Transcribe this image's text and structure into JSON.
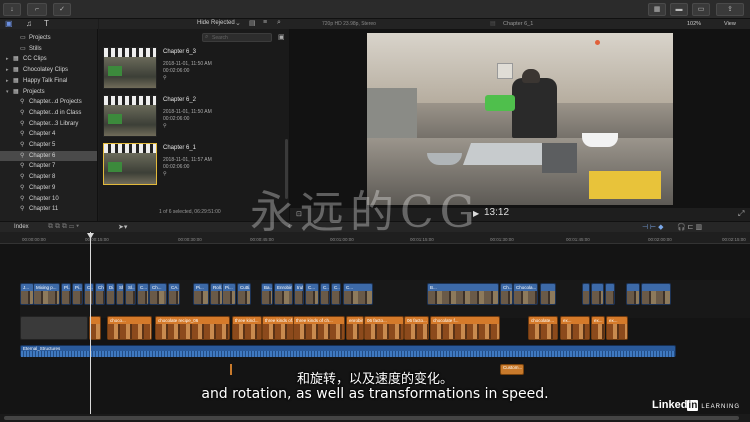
{
  "toolbar": {
    "filter_label": "Hide Rejected",
    "format": "720p HD 23.98p, Stereo",
    "viewer_title": "Chapter 6_1",
    "zoom": "102%",
    "view": "View"
  },
  "sidebar": {
    "items": [
      {
        "label": "Projects",
        "kind": "folder",
        "indent": 1
      },
      {
        "label": "Stills",
        "kind": "folder",
        "indent": 1
      },
      {
        "label": "CC Clips",
        "kind": "event",
        "indent": 0
      },
      {
        "label": "Chocolatey Clips",
        "kind": "event",
        "indent": 0
      },
      {
        "label": "Happy Talk Final",
        "kind": "event",
        "indent": 0
      },
      {
        "label": "Projects",
        "kind": "event",
        "indent": 0
      },
      {
        "label": "Chapter...d Projects",
        "kind": "keyword",
        "indent": 1
      },
      {
        "label": "Chapter...d in Class",
        "kind": "keyword",
        "indent": 1
      },
      {
        "label": "Chapter...3 Library",
        "kind": "keyword",
        "indent": 1
      },
      {
        "label": "Chapter 4",
        "kind": "keyword",
        "indent": 1
      },
      {
        "label": "Chapter 5",
        "kind": "keyword",
        "indent": 1
      },
      {
        "label": "Chapter 6",
        "kind": "keyword",
        "indent": 1,
        "selected": true
      },
      {
        "label": "Chapter 7",
        "kind": "keyword",
        "indent": 1
      },
      {
        "label": "Chapter 8",
        "kind": "keyword",
        "indent": 1
      },
      {
        "label": "Chapter 9",
        "kind": "keyword",
        "indent": 1
      },
      {
        "label": "Chapter 10",
        "kind": "keyword",
        "indent": 1
      },
      {
        "label": "Chapter 11",
        "kind": "keyword",
        "indent": 1
      }
    ]
  },
  "browser": {
    "search_placeholder": "Search",
    "clips": [
      {
        "title": "Chapter 6_3",
        "date": "2018-11-01, 11:50 AM",
        "duration": "00:02:06:00"
      },
      {
        "title": "Chapter 6_2",
        "date": "2018-11-01, 11:50 AM",
        "duration": "00:02:06:00"
      },
      {
        "title": "Chapter 6_1",
        "date": "2018-11-01, 11:57 AM",
        "duration": "00:02:06:00",
        "selected": true
      }
    ],
    "status": "1 of 6 selected, 06:29:51:00"
  },
  "viewer": {
    "timecode": "13:12"
  },
  "timeline": {
    "index_label": "Index",
    "ruler": [
      "00:00:00:00",
      "00:00:15:00",
      "00:00:30:00",
      "00:00:45:00",
      "00:01:00:00",
      "00:01:15:00",
      "00:01:30:00",
      "00:01:45:00",
      "00:02:00:00",
      "00:02:15:00"
    ],
    "connected_clips": [
      {
        "label": "J..."
      },
      {
        "label": "Mixing p..."
      },
      {
        "label": "Pl..."
      },
      {
        "label": "Pi..."
      },
      {
        "label": "C..."
      },
      {
        "label": "Ch..."
      },
      {
        "label": "Di..."
      },
      {
        "label": "Shop..."
      },
      {
        "label": "Sl..."
      },
      {
        "label": "C..."
      },
      {
        "label": "Ch..."
      },
      {
        "label": "CA..."
      },
      {
        "label": "Pi..."
      },
      {
        "label": "Roll..."
      },
      {
        "label": "Pi..."
      },
      {
        "label": "Cutti..."
      },
      {
        "label": "Ba..."
      },
      {
        "label": "Enrobing..."
      },
      {
        "label": "truffle_page.png"
      },
      {
        "label": "C..."
      },
      {
        "label": "C..."
      },
      {
        "label": "C..."
      },
      {
        "label": "C..."
      },
      {
        "label": "B..."
      },
      {
        "label": "Ch..."
      },
      {
        "label": "Chocola..."
      }
    ],
    "primary_clips": [
      {
        "label": ""
      },
      {
        "label": "choco..."
      },
      {
        "label": "chocolate recipe_06"
      },
      {
        "label": "three kind..."
      },
      {
        "label": "three kinds of..."
      },
      {
        "label": "three kinds of ch..."
      },
      {
        "label": "enrobing ch..."
      },
      {
        "label": "06 facto..."
      },
      {
        "label": "06 facto..."
      },
      {
        "label": "chocolate f..."
      },
      {
        "label": "chocolate..."
      },
      {
        "label": "ex..."
      },
      {
        "label": "ex..."
      },
      {
        "label": "ex..."
      }
    ],
    "audio_label": "Eternal_Structures",
    "title_clip": "Custom..."
  },
  "subtitles": {
    "chinese": "和旋转，以及速度的变化。",
    "english": "and rotation, as well as transformations in speed."
  },
  "watermark": "永远的CG",
  "brand": {
    "name": "Linked",
    "in": "in",
    "suffix": "LEARNING"
  },
  "colors": {
    "primary_clip": "#d57a2a",
    "connected_clip": "#3d6aa8",
    "audio": "#2a5a9a",
    "accent_selection": "#e2b93b"
  }
}
